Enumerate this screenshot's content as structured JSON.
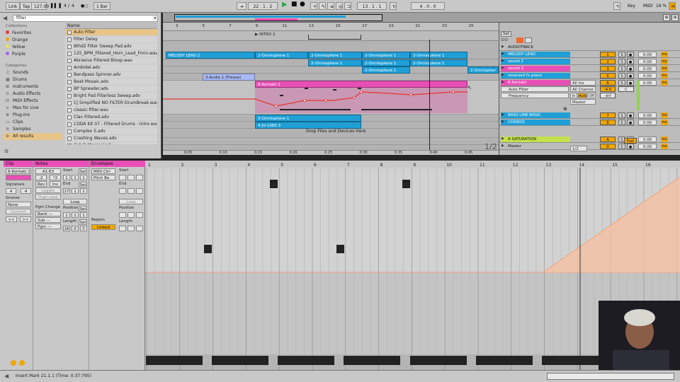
{
  "control_bar": {
    "link": "Link",
    "tap": "Tap",
    "tempo": "127.00",
    "signature_num": "4",
    "signature_den": "4",
    "metronome": "●○",
    "quantize": "1 Bar",
    "arrangement_position": "22 .  1 .  2",
    "loop_start": "13 .  1 .  1",
    "loop_length": "4 .  0 .  0",
    "key": "Key",
    "midi": "MIDI",
    "cpu": "16 %"
  },
  "browser": {
    "search_value": "filter",
    "collections_header": "Collections",
    "collections": [
      {
        "label": "Favorites",
        "color": "#e0393e"
      },
      {
        "label": "Orange",
        "color": "#f0a020"
      },
      {
        "label": "Yellow",
        "color": "#e8e060"
      },
      {
        "label": "Purple",
        "color": "#a06ae0"
      }
    ],
    "categories_header": "Categories",
    "categories": [
      "Sounds",
      "Drums",
      "Instruments",
      "Audio Effects",
      "MIDI Effects",
      "Max for Live",
      "Plug-Ins",
      "Clips",
      "Samples",
      "All results"
    ],
    "name_header": "Name",
    "files": [
      "Auto Filter",
      "Filter Delay",
      "8thd2 Filter Sweep Pad.adv",
      "125_BPM_Filtered_Horn_Lead_Fmin.wav",
      "Abrasive Filtered Bloop.wav",
      "Ambidel.adv",
      "Bandpass Spinner.adv",
      "Beat Mosaic.adv",
      "BP Spreader.adv",
      "Bright Pad Filterless Sweep.adv",
      "CJ Simplified NO FILTER DrumBreak.wav",
      "classic filter.wav",
      "Clav Filtered.adv",
      "CODA Kit 07 - Filtered Drums - Intro.wav",
      "Complex 5.adv",
      "Crashing Waves.adv",
      "Cut-O-Magic V.adv"
    ]
  },
  "arrangement": {
    "ruler_bars": [
      "3",
      "5",
      "7",
      "9",
      "11",
      "13",
      "15",
      "17",
      "19",
      "21",
      "23",
      "25"
    ],
    "time_labels": [
      "0:05",
      "0:10",
      "0:15",
      "0:20",
      "0:25",
      "0:30",
      "0:35",
      "0:40",
      "0:45"
    ],
    "locator": "INTRO 2",
    "zoom_label": "1/2",
    "drop_text": "Drop Files and Devices Here",
    "clips": {
      "melody_lead_1": "MELODY LEAD 2",
      "omni_a": "2-Omnisphere 1",
      "omni_b": "2-Omnisphere 1",
      "omni_c": "2-Omnisphere 1",
      "omni_d": "2-Omnisphere 1",
      "omni_e": "2-Omnisphere 1",
      "omni_f": "2-Omnisphere 1",
      "omni_g": "2-Omnisphere 1",
      "omni_h": "2-Omnisphere 1",
      "omni_i": "2-Omnispher",
      "audio_freeze": "3-Audio 1 (Freeze)",
      "kontakt": "6-Kontakt 1",
      "bass_omni": "3-Omnisphere 1",
      "chords_jv": "4-JV-1080 3"
    }
  },
  "mixer": {
    "set_label": "Set",
    "tracks": [
      {
        "name": "AUDIOTRACK",
        "num": "",
        "vol": "",
        "color": "#bcbcbc"
      },
      {
        "name": "MELODY LEAD",
        "num": "1",
        "vol": "0.00",
        "color": "#1f9fd6"
      },
      {
        "name": "sound 2",
        "num": "2",
        "vol": "0.00",
        "color": "#1f9fd6"
      },
      {
        "name": "sound 3",
        "num": "3",
        "vol": "0.00",
        "color": "#e84fb6"
      },
      {
        "name": "reversed fx piano",
        "num": "5",
        "vol": "0.00",
        "color": "#1f9fd6"
      },
      {
        "name": "6 Kontakt",
        "num": "6",
        "vol": "0.00",
        "color": "#e84fb6"
      },
      {
        "name": "BASS LINE BASIC",
        "num": "7",
        "vol": "0.00",
        "color": "#1f9fd6"
      },
      {
        "name": "CHORDS",
        "num": "8",
        "vol": "0.00",
        "color": "#1f9fd6"
      },
      {
        "name": "A SATURATION",
        "num": "A",
        "vol": "0.00",
        "color": "#c5e04d"
      },
      {
        "name": "Master",
        "num": "0",
        "vol": "0.00",
        "color": "#bcbcbc"
      }
    ],
    "auto_filter": "Auto Filter",
    "frequency": "Frequency",
    "all_ins": "All Ins",
    "all_channels": "All Channe",
    "in": "In",
    "auto": "Auto",
    "off": "Off",
    "master_out": "Master",
    "kontakt_vol": "-4.6",
    "kontakt_c": "C",
    "kontakt_inf": "-inf",
    "master_ratio": "1/2",
    "post": "Post"
  },
  "clip_view": {
    "clip_header": "Clip",
    "clip_name": "6-Kontakt 1",
    "signature_label": "Signature",
    "sig_num": "4",
    "sig_den": "4",
    "groove_label": "Groove",
    "groove_value": "None",
    "commit": "Commit",
    "notes_header": "Notes",
    "notes_range": "A1-E3",
    "rev": "Rev",
    "inv": "Inv",
    "legato": "Legato",
    "dupl_loop": "Dupl.Loop",
    "pgm_change": "Pgm Change",
    "bank": "Bank ---",
    "sub": "Sub ---",
    "pgm": "Pgm ---",
    "start_label": "Start",
    "start_v": "1",
    "end_label": "End",
    "end_v": "17",
    "loop_label": "Loop",
    "position_label": "Position",
    "length_label": "Length",
    "length_v": "16",
    "set_label": "Set",
    "envelopes_header": "Envelopes",
    "env_device": "MIDI Ctrl",
    "env_param": "Pitch Be",
    "region_label": "Region",
    "linked": "Linked",
    "env_start": "Start",
    "env_end": "End",
    "env_loop": "Loop",
    "env_position": "Position",
    "env_length": "Length"
  },
  "editor": {
    "bars": [
      "1",
      "2",
      "3",
      "4",
      "5",
      "6",
      "7",
      "8",
      "9",
      "10",
      "11",
      "12",
      "13",
      "14",
      "15",
      "16"
    ]
  },
  "status": {
    "text": "Insert Mark 21.1.1 (Time: 0:37:795)"
  }
}
